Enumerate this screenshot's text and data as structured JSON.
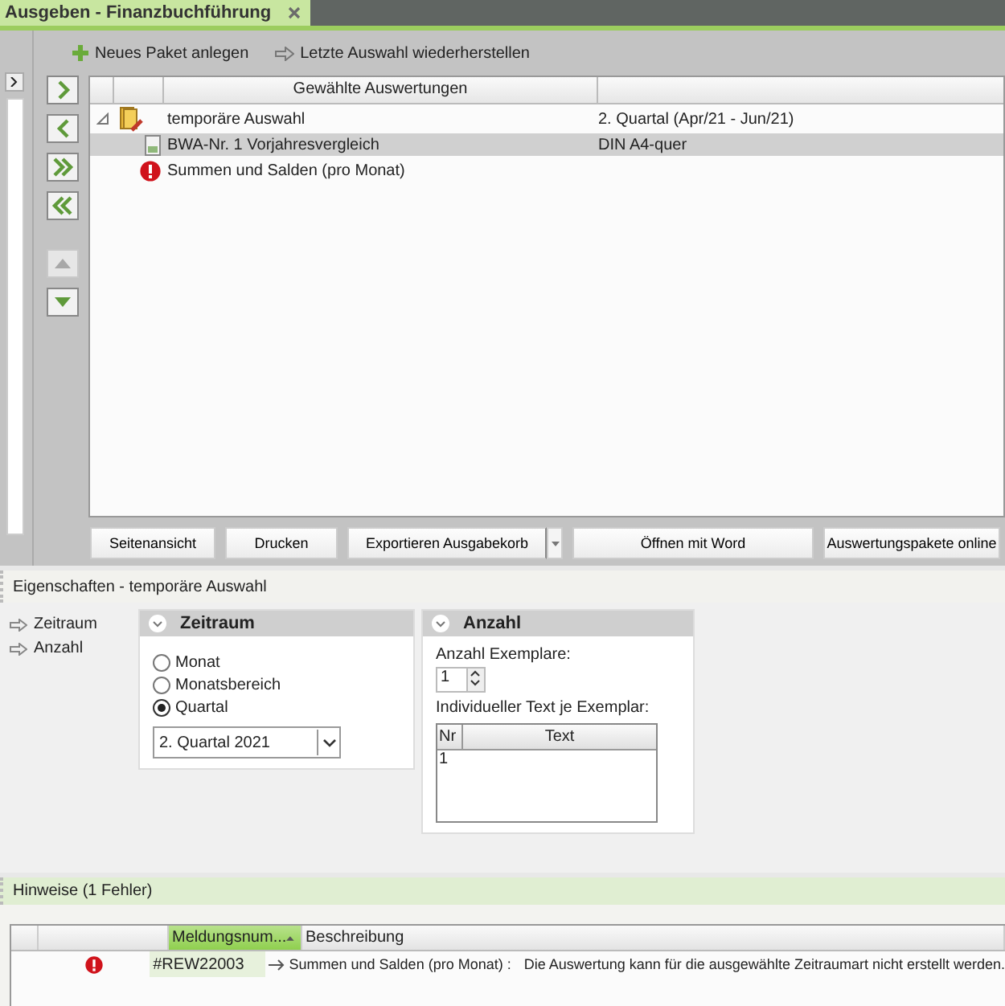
{
  "tab": {
    "title": "Ausgeben - Finanzbuchführung",
    "selected": true
  },
  "toolbar": [
    {
      "label": "Neues Paket anlegen",
      "kind": "add"
    },
    {
      "label": "Letzte Auswahl wiederherstellen",
      "kind": "restore"
    }
  ],
  "side_buttons": [
    {
      "kind": "right",
      "disabled": false
    },
    {
      "kind": "left",
      "disabled": false
    },
    {
      "kind": "all-right",
      "disabled": false
    },
    {
      "kind": "all-left",
      "disabled": false
    },
    {
      "kind": "up",
      "disabled": true
    },
    {
      "kind": "down",
      "disabled": false
    }
  ],
  "tree": {
    "columns": [
      "Gewählte Auswertungen"
    ],
    "rows": [
      {
        "label": "temporäre Auswahl",
        "value": "2. Quartal (Apr/21 - Jun/21)",
        "kind": "folder",
        "expanded": true,
        "selected": false,
        "children": [
          {
            "label": "BWA-Nr. 1 Vorjahresvergleich",
            "value": "DIN A4-quer",
            "kind": "document",
            "selected": true
          },
          {
            "label": "Summen und Salden (pro Monat)",
            "kind": "error",
            "selected": false
          }
        ]
      }
    ]
  },
  "actions": [
    {
      "label": "Seitenansicht",
      "dropdown": false
    },
    {
      "label": "Drucken",
      "dropdown": false
    },
    {
      "label": "Exportieren Ausgabekorb",
      "dropdown": true
    },
    {
      "label": "Öffnen mit Word",
      "dropdown": false
    },
    {
      "label": "Auswertungspakete online",
      "dropdown": false
    }
  ],
  "properties": {
    "title": "Eigenschaften - temporäre Auswahl",
    "nav": [
      "Zeitraum",
      "Anzahl"
    ],
    "zeitraum": {
      "title": "Zeitraum",
      "options": [
        {
          "label": "Monat",
          "selected": false
        },
        {
          "label": "Monatsbereich",
          "selected": false
        },
        {
          "label": "Quartal",
          "selected": true
        }
      ],
      "period": "2. Quartal 2021"
    },
    "anzahl": {
      "title": "Anzahl",
      "copies_label": "Anzahl Exemplare:",
      "copies": "1",
      "text_label": "Individueller Text je Exemplar:",
      "columns": [
        "Nr",
        "Text"
      ],
      "rows": [
        [
          "1"
        ]
      ]
    }
  },
  "messages": {
    "title": "Hinweise (1 Fehler)",
    "columns": [
      {
        "label": "Meldungsnum...",
        "sorted": true
      },
      {
        "label": "Beschreibung",
        "sorted": false
      }
    ],
    "rows": [
      {
        "kind": "error",
        "number": "#REW22003",
        "source": "Summen und Salden (pro Monat) :",
        "text": "Die Auswertung kann für die ausgewählte Zeitraumart nicht erstellt werden."
      }
    ]
  }
}
